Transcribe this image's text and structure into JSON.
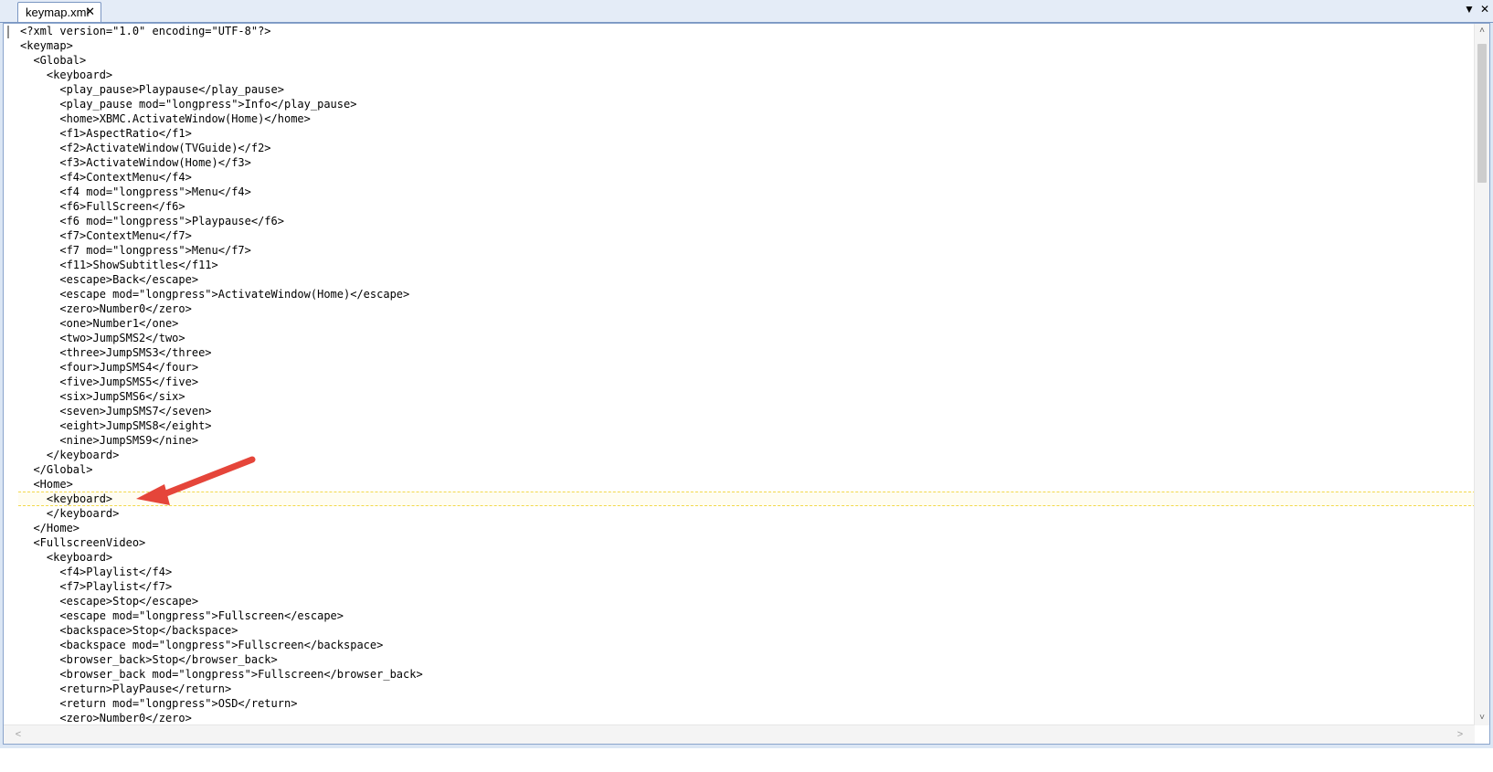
{
  "tab": {
    "title": "keymap.xml",
    "close_glyph": "✕"
  },
  "window_controls": {
    "dropdown_glyph": "▼",
    "close_glyph": "✕"
  },
  "code_lines": [
    "<?xml version=\"1.0\" encoding=\"UTF-8\"?>",
    "<keymap>",
    "  <Global>",
    "    <keyboard>",
    "      <play_pause>Playpause</play_pause>",
    "      <play_pause mod=\"longpress\">Info</play_pause>",
    "      <home>XBMC.ActivateWindow(Home)</home>",
    "      <f1>AspectRatio</f1>",
    "      <f2>ActivateWindow(TVGuide)</f2>",
    "      <f3>ActivateWindow(Home)</f3>",
    "      <f4>ContextMenu</f4>",
    "      <f4 mod=\"longpress\">Menu</f4>",
    "      <f6>FullScreen</f6>",
    "      <f6 mod=\"longpress\">Playpause</f6>",
    "      <f7>ContextMenu</f7>",
    "      <f7 mod=\"longpress\">Menu</f7>",
    "      <f11>ShowSubtitles</f11>",
    "      <escape>Back</escape>",
    "      <escape mod=\"longpress\">ActivateWindow(Home)</escape>",
    "      <zero>Number0</zero>",
    "      <one>Number1</one>",
    "      <two>JumpSMS2</two>",
    "      <three>JumpSMS3</three>",
    "      <four>JumpSMS4</four>",
    "      <five>JumpSMS5</five>",
    "      <six>JumpSMS6</six>",
    "      <seven>JumpSMS7</seven>",
    "      <eight>JumpSMS8</eight>",
    "      <nine>JumpSMS9</nine>",
    "    </keyboard>",
    "  </Global>",
    "  <Home>",
    "    <keyboard>",
    "    </keyboard>",
    "  </Home>",
    "  <FullscreenVideo>",
    "    <keyboard>",
    "      <f4>Playlist</f4>",
    "      <f7>Playlist</f7>",
    "      <escape>Stop</escape>",
    "      <escape mod=\"longpress\">Fullscreen</escape>",
    "      <backspace>Stop</backspace>",
    "      <backspace mod=\"longpress\">Fullscreen</backspace>",
    "      <browser_back>Stop</browser_back>",
    "      <browser_back mod=\"longpress\">Fullscreen</browser_back>",
    "      <return>PlayPause</return>",
    "      <return mod=\"longpress\">OSD</return>",
    "      <zero>Number0</zero>"
  ],
  "highlighted_line_number": 33,
  "annotation": {
    "type": "arrow",
    "color": "#e5453a",
    "points_to_line": 33
  },
  "scrollbars": {
    "up_glyph": "˄",
    "down_glyph": "˅",
    "left_glyph": "<",
    "right_glyph": ">"
  },
  "colors": {
    "accent_border": "#7a96c2",
    "highlight_border": "#f2d84b",
    "arrow": "#e5453a"
  }
}
